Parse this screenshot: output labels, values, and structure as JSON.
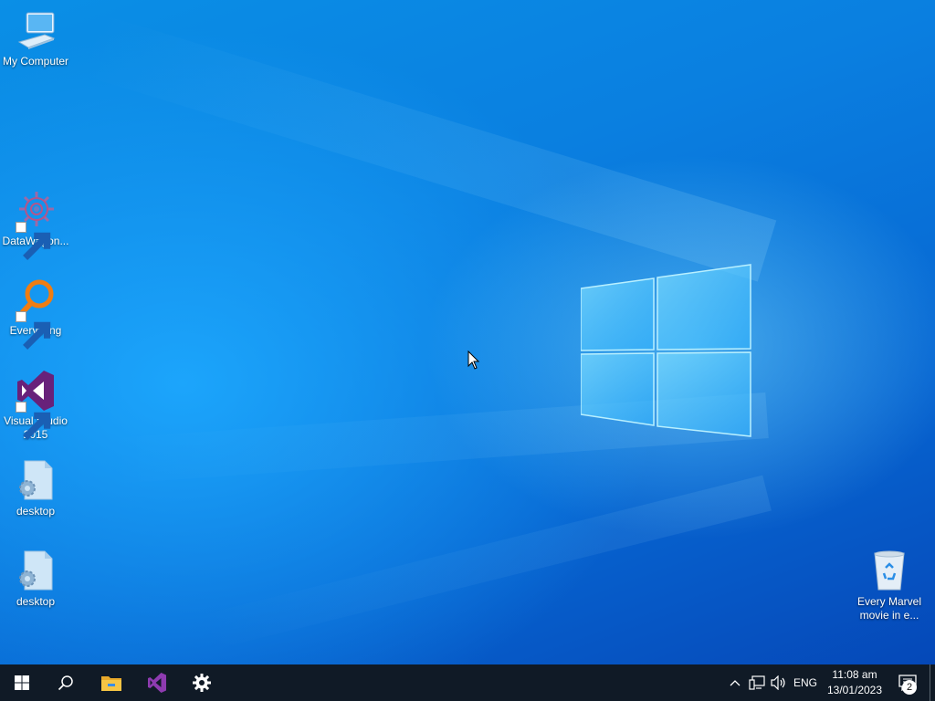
{
  "desktop": {
    "icons": [
      {
        "label": "My Computer",
        "icon": "computer-icon"
      },
      {
        "label": "DataWagon...",
        "icon": "datawagon-icon"
      },
      {
        "label": "Everything",
        "icon": "everything-search-icon"
      },
      {
        "label": "Visual Studio 2015",
        "icon": "visual-studio-icon"
      },
      {
        "label": "desktop",
        "icon": "config-file-icon"
      },
      {
        "label": "desktop",
        "icon": "config-file-icon"
      },
      {
        "label": "Every Marvel movie in e...",
        "icon": "recycle-bin-icon"
      }
    ]
  },
  "taskbar": {
    "start": "windows-start-icon",
    "search": "search-icon",
    "pinned": [
      "file-explorer-icon",
      "visual-studio-icon",
      "settings-gear-icon"
    ],
    "tray": {
      "chevron": "chevron-up-icon",
      "network": "network-icon",
      "volume": "volume-icon",
      "language": "ENG",
      "time": "11:08 am",
      "date": "13/01/2023",
      "notifications_count": "2"
    }
  },
  "colors": {
    "taskbar": "#101a26",
    "wallpaper": "#0a7fe0",
    "vs_purple": "#68217a"
  }
}
